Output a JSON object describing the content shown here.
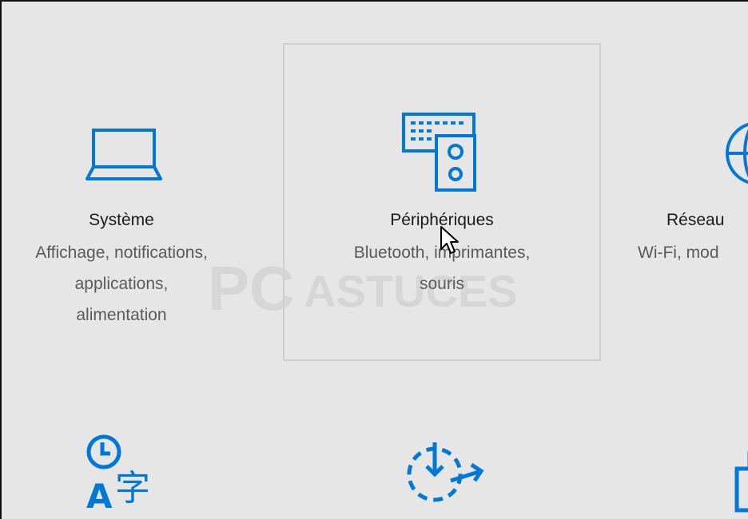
{
  "tiles": [
    {
      "title": "Système",
      "desc": [
        "Affichage, notifications,",
        "applications,",
        "alimentation"
      ],
      "icon": "laptop-icon"
    },
    {
      "title": "Périphériques",
      "desc": [
        "Bluetooth, imprimantes,",
        "souris"
      ],
      "icon": "devices-icon"
    },
    {
      "title": "Réseau",
      "desc": [
        "Wi-Fi, mod"
      ],
      "icon": "globe-icon"
    }
  ],
  "bottom_icons": [
    "time-language-icon",
    "update-security-icon",
    "lock-icon"
  ],
  "watermark": {
    "part1": "PC",
    "part2": "ASTUCES"
  },
  "colors": {
    "accent": "#0078d7",
    "background": "#e6e6e6"
  }
}
